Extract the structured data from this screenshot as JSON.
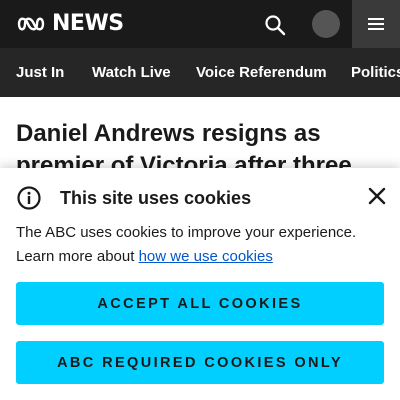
{
  "header": {
    "logo_text": "NEWS",
    "logo_icon": "abc-logo-icon",
    "search_icon": "search-icon",
    "avatar_icon": "avatar",
    "menu_icon": "hamburger-menu-icon"
  },
  "nav": {
    "items": [
      {
        "label": "Just In"
      },
      {
        "label": "Watch Live"
      },
      {
        "label": "Voice Referendum"
      },
      {
        "label": "Politics"
      }
    ]
  },
  "article": {
    "headline": "Daniel Andrews resigns as premier of Victoria after three"
  },
  "cookie_banner": {
    "title": "This site uses cookies",
    "body_text": "The ABC uses cookies to improve your experience. Learn more about",
    "link_text": "how we use cookies",
    "accept_all_label": "ACCEPT ALL COOKIES",
    "required_only_label": "ABC REQUIRED COOKIES ONLY",
    "info_icon": "info-icon",
    "close_icon": "close-icon",
    "accent_color": "#00cfff",
    "link_color": "#0058cc"
  }
}
